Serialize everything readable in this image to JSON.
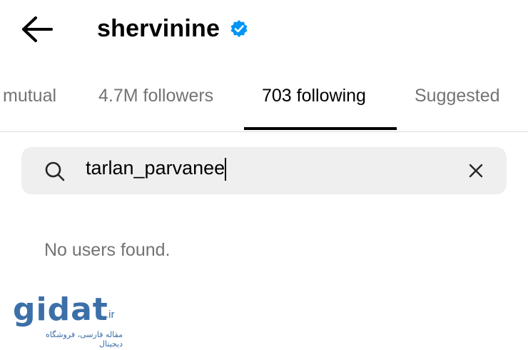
{
  "header": {
    "back_icon": "arrow-left-icon",
    "username": "shervinine",
    "verified_icon": "verified-badge-icon",
    "verified_color": "#0095f6"
  },
  "tabs": [
    {
      "label": "mutual",
      "active": false
    },
    {
      "label": "4.7M followers",
      "active": false
    },
    {
      "label": "703 following",
      "active": true
    },
    {
      "label": "Suggested",
      "active": false
    }
  ],
  "search": {
    "icon": "search-icon",
    "value": "tarlan_parvanee",
    "clear_icon": "close-icon"
  },
  "results": {
    "empty_message": "No users found."
  },
  "watermark": {
    "brand": "gidat",
    "tld": ".ir",
    "tagline": "مقاله فارسی، فروشگاه دیجیتال"
  },
  "colors": {
    "active_tab": "#000000",
    "inactive_tab": "#737373",
    "search_bg": "#efefef",
    "watermark": "#3c6fa8"
  }
}
